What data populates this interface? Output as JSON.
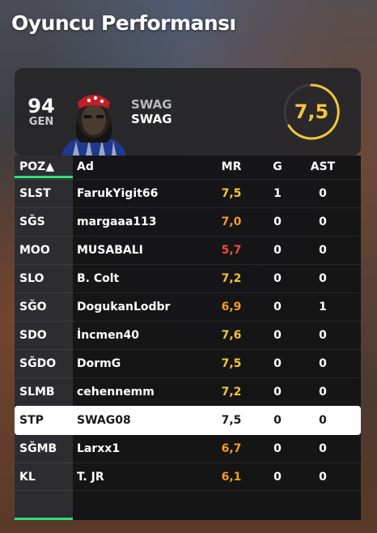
{
  "header": {
    "title": "Oyuncu Performansı"
  },
  "player_card": {
    "overall": "94",
    "overall_label": "GEN",
    "name_line1": "SWAG",
    "name_line2": "SWAG",
    "match_rating": "7,5",
    "rating_color": "#f3c53b"
  },
  "table": {
    "columns": {
      "poz": "POZ▲",
      "ad": "Ad",
      "mr": "MR",
      "g": "G",
      "ast": "AST"
    },
    "sort_indicator_color": "#2fe07a",
    "rows": [
      {
        "poz": "SLST",
        "ad": "FarukYigit66",
        "mr": "7,5",
        "g": "1",
        "ast": "0",
        "mr_color": "#f3c53b"
      },
      {
        "poz": "SĞS",
        "ad": "margaaa113",
        "mr": "7,0",
        "g": "0",
        "ast": "0",
        "mr_color": "#f39a2a"
      },
      {
        "poz": "MOO",
        "ad": "MUSABALI",
        "mr": "5,7",
        "g": "0",
        "ast": "0",
        "mr_color": "#ee4b3b"
      },
      {
        "poz": "SLO",
        "ad": "B. Colt",
        "mr": "7,2",
        "g": "0",
        "ast": "0",
        "mr_color": "#f3c53b"
      },
      {
        "poz": "SĞO",
        "ad": "DogukanLodbr",
        "mr": "6,9",
        "g": "0",
        "ast": "1",
        "mr_color": "#f39a2a"
      },
      {
        "poz": "SDO",
        "ad": "İncmen40",
        "mr": "7,6",
        "g": "0",
        "ast": "0",
        "mr_color": "#f3c53b"
      },
      {
        "poz": "SĞDO",
        "ad": "DormG",
        "mr": "7,5",
        "g": "0",
        "ast": "0",
        "mr_color": "#f3c53b"
      },
      {
        "poz": "SLMB",
        "ad": "cehennemm",
        "mr": "7,2",
        "g": "0",
        "ast": "0",
        "mr_color": "#f3c53b"
      },
      {
        "poz": "STP",
        "ad": "SWAG08",
        "mr": "7,5",
        "g": "0",
        "ast": "0",
        "mr_color": "#1a1a1a",
        "selected": true
      },
      {
        "poz": "SĞMB",
        "ad": "Larxx1",
        "mr": "6,7",
        "g": "0",
        "ast": "0",
        "mr_color": "#f39a2a"
      },
      {
        "poz": "KL",
        "ad": "T. JR",
        "mr": "6,1",
        "g": "0",
        "ast": "0",
        "mr_color": "#f39a2a"
      }
    ]
  }
}
